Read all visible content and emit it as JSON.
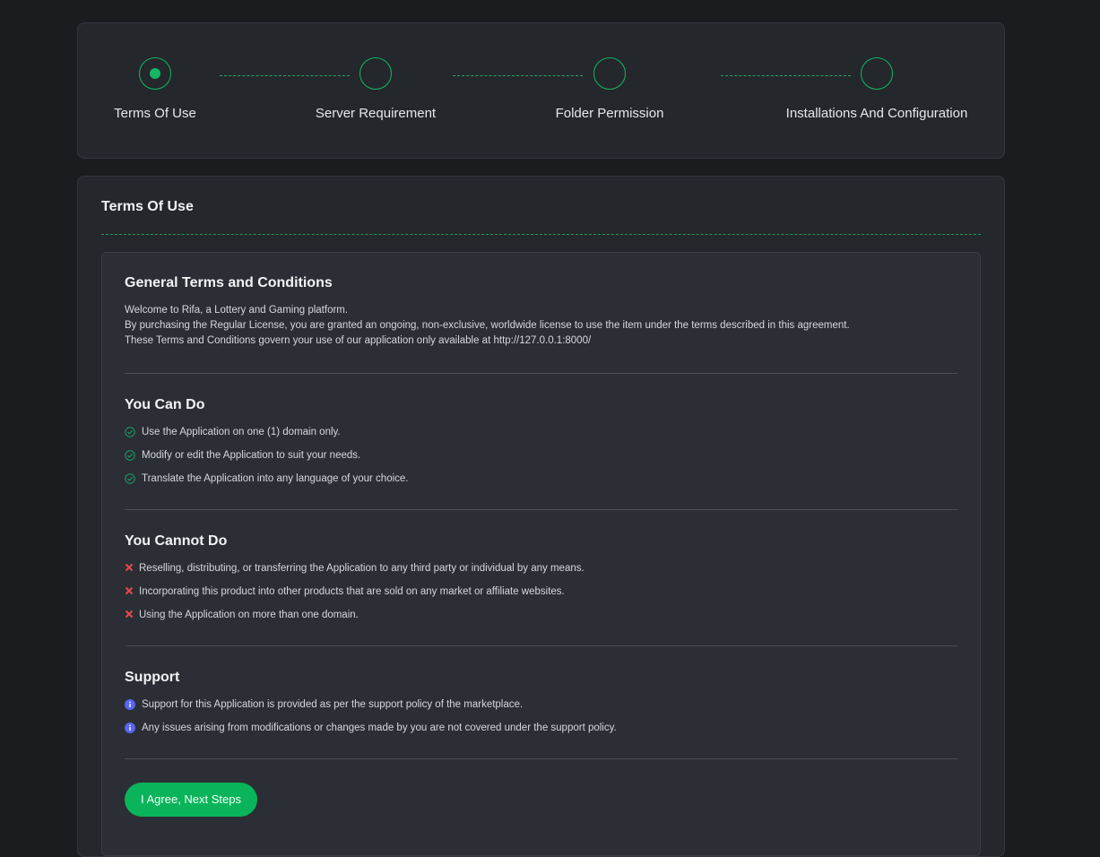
{
  "stepper": {
    "steps": [
      {
        "label": "Terms Of Use",
        "active": true
      },
      {
        "label": "Server Requirement",
        "active": false
      },
      {
        "label": "Folder Permission",
        "active": false
      },
      {
        "label": "Installations And Configuration",
        "active": false
      }
    ]
  },
  "terms_card": {
    "title": "Terms Of Use",
    "general": {
      "title": "General Terms and Conditions",
      "lines": [
        "Welcome to Rifa, a Lottery and Gaming platform.",
        "By purchasing the Regular License, you are granted an ongoing, non-exclusive, worldwide license to use the item under the terms described in this agreement.",
        "These Terms and Conditions govern your use of our application only available at http://127.0.0.1:8000/"
      ]
    },
    "can_do": {
      "title": "You Can Do",
      "items": [
        "Use the Application on one (1) domain only.",
        "Modify or edit the Application to suit your needs.",
        "Translate the Application into any language of your choice."
      ]
    },
    "cannot_do": {
      "title": "You Cannot Do",
      "items": [
        "Reselling, distributing, or transferring the Application to any third party or individual by any means.",
        "Incorporating this product into other products that are sold on any market or affiliate websites.",
        "Using the Application on more than one domain."
      ]
    },
    "support": {
      "title": "Support",
      "items": [
        "Support for this Application is provided as per the support policy of the marketplace.",
        "Any issues arising from modifications or changes made by you are not covered under the support policy."
      ]
    },
    "agree_button": "I Agree, Next Steps"
  },
  "colors": {
    "accent": "#0ab45a",
    "error": "#e34b4b",
    "info": "#5865f2",
    "check": "#1aa36a"
  },
  "icons": {
    "can_do": "check-circle-icon",
    "cannot_do": "x-icon",
    "support": "info-circle-icon",
    "active_step": "step-dot-icon"
  }
}
